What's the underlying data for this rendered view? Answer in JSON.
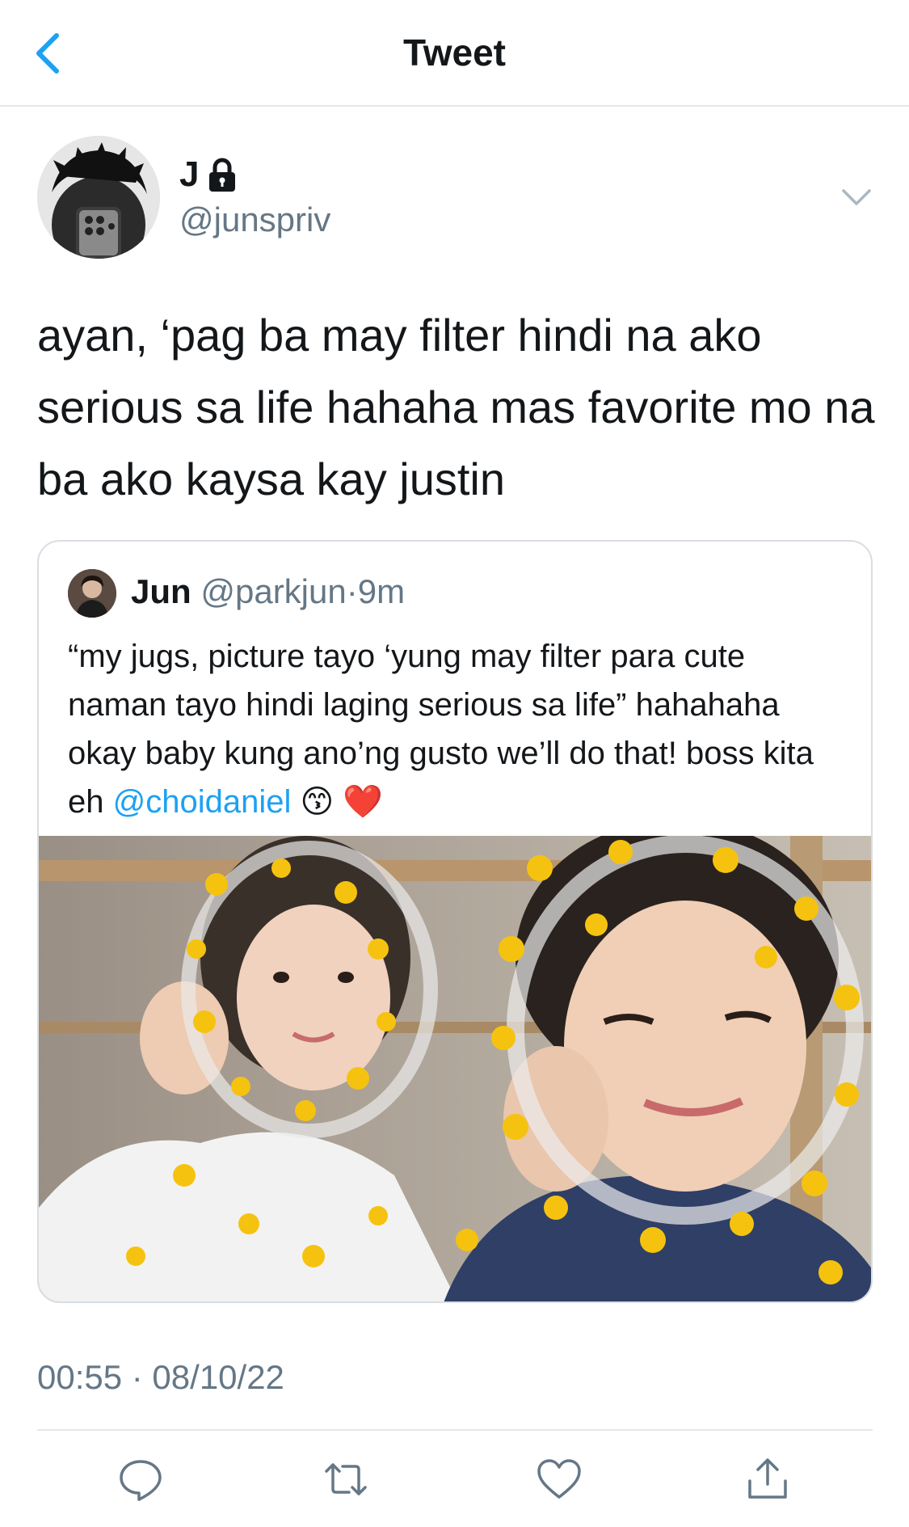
{
  "nav": {
    "title": "Tweet"
  },
  "tweet": {
    "display_name": "J",
    "handle": "@junspriv",
    "text": "ayan, ‘pag ba may filter hindi na ako serious sa life hahaha mas favorite mo na ba ako kaysa kay justin",
    "timestamp": "00:55 · 08/10/22"
  },
  "quoted": {
    "name": "Jun",
    "handle": "@parkjun",
    "dot": "·",
    "time": "9m",
    "text": "“my jugs, picture tayo ‘yung may filter para cute naman tayo hindi laging serious sa life” hahahaha okay baby kung ano’ng gusto we’ll do that! boss kita eh ",
    "mention": "@choidaniel",
    "emoji": "😙 ❤️"
  },
  "icons": {
    "back": "chevron-left-icon",
    "lock": "lock-icon",
    "caret": "chevron-down-icon",
    "reply": "reply-icon",
    "retweet": "retweet-icon",
    "like": "heart-icon",
    "share": "share-icon"
  },
  "colors": {
    "accent": "#1da1f2",
    "secondary_text": "#657786",
    "divider": "#e1e8ed"
  }
}
